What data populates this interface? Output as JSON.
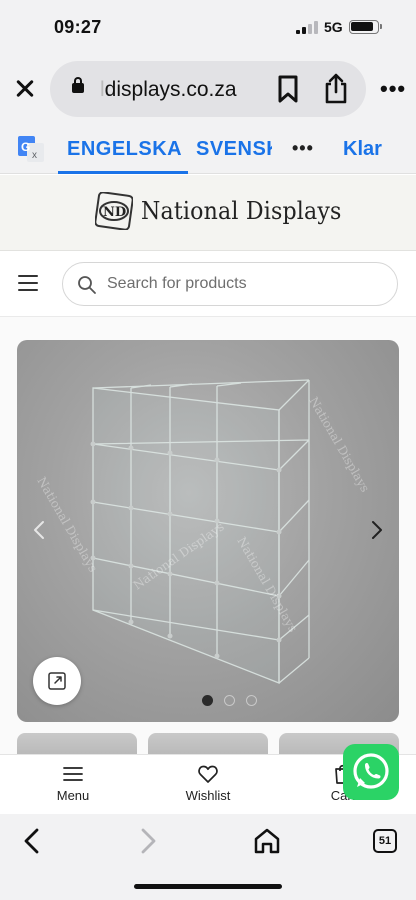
{
  "status_bar": {
    "time": "09:27",
    "network": "5G",
    "icons": [
      "signal-icon",
      "battery-icon"
    ]
  },
  "browser": {
    "url_faded": "l",
    "url_visible": "displays.co.za",
    "icons": [
      "close-icon",
      "lock-icon",
      "bookmark-icon",
      "share-icon",
      "more-icon"
    ]
  },
  "translate_bar": {
    "lang_primary": "ENGELSKA",
    "lang_secondary": "SVENSK",
    "more": "•••",
    "done": "Klar",
    "accent_color": "#1a73e8",
    "icons": [
      "google-translate-icon"
    ]
  },
  "site": {
    "logo_text": "National Displays",
    "search": {
      "placeholder": "Search for products",
      "value": ""
    }
  },
  "gallery": {
    "watermark": "National Displays",
    "image_count": 3,
    "active_index": 0,
    "icons": [
      "chevron-left-icon",
      "chevron-right-icon",
      "expand-icon"
    ]
  },
  "bottom_nav": {
    "items": [
      {
        "label": "Menu",
        "icon": "hamburger-icon"
      },
      {
        "label": "Wishlist",
        "icon": "heart-icon"
      },
      {
        "label": "Cart",
        "icon": "cart-icon"
      }
    ],
    "whatsapp_color": "#2bd366"
  },
  "safari_bottom": {
    "tab_count": "51",
    "icons": [
      "back-icon",
      "forward-icon",
      "home-icon",
      "tabs-icon"
    ]
  }
}
